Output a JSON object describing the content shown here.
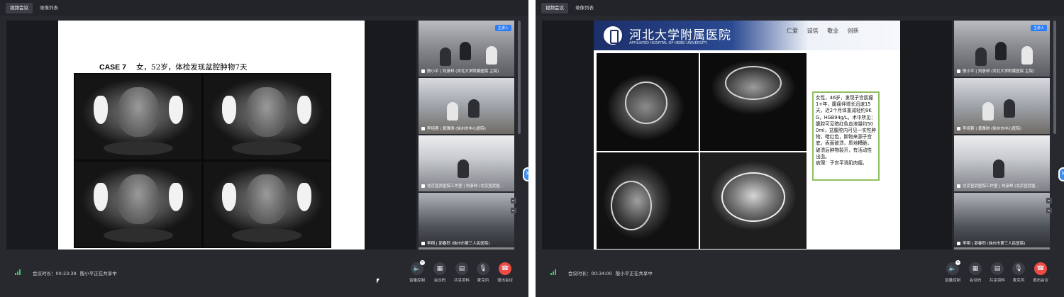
{
  "tabs": [
    "视频会议",
    "录像列表"
  ],
  "speaker_badge": "主讲人",
  "participants": [
    "殷小平 | 刘彦邦 (河北大学附属医院 主院)",
    "李培蓉 | 黄雅琪 (徐州市中心医院)",
    "北京宣武医院工作室 | 刘彦邦 (北京宣武医...",
    "李翔 | 郭春烈 (徐州市第三人民医院)"
  ],
  "controls": [
    "音量控制",
    "会议码",
    "共享资料",
    "麦克风",
    "退出会议"
  ],
  "left": {
    "duration": "会议时长：00:23:39",
    "sharing": "殷小平正在共享中",
    "slide": {
      "case_number": "CASE 7",
      "case_text": "女，52岁，体检发现盆腔肿物7天"
    }
  },
  "right": {
    "duration": "会议时长：00:34:00",
    "sharing": "殷小平正在共享中",
    "slide": {
      "hospital_name": "河北大学附属医院",
      "hospital_name_en": "AFFILIATED HOSPITAL OF HEBEI UNIVERSITY",
      "motto": "仁爱 诚信 敬业 创新",
      "case_history": "女性，46岁，发现子宫肌瘤1+年，腹痛伴增长迅速15天，近2个月体重减轻约9KG，HGB94g/L。术中所见：腹腔可见暗红色血液量约500ml，盆腹腔内可见一实性肿物，暗红色，肿物来源子宫底，表面破溃，质地糟脆，破溃后肿物裂开，有活动性出血。",
      "pathology": "病理：子宫平滑肌肉瘤。"
    }
  },
  "colors": {
    "window_bg": "#27292f",
    "leave_button": "#f04a45",
    "speaker_badge": "#2f7ef7",
    "signal": "#43c26a",
    "case_box_border": "#8fbf60"
  }
}
